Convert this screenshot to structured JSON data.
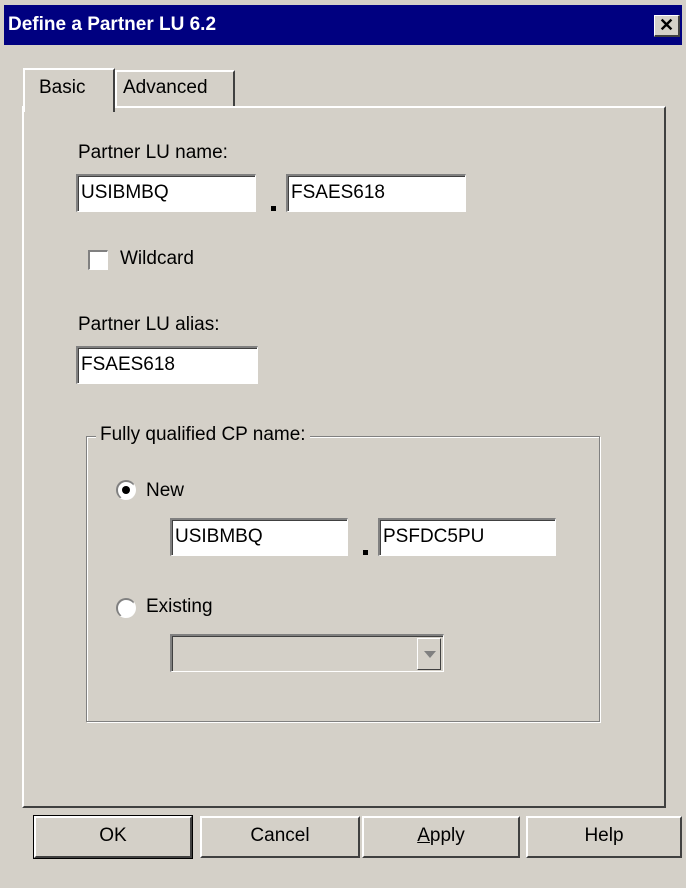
{
  "window": {
    "title": "Define a Partner LU 6.2",
    "close_glyph": "✕"
  },
  "tabs": [
    {
      "label": "Basic",
      "selected": true
    },
    {
      "label": "Advanced",
      "selected": false
    }
  ],
  "partner_lu_name": {
    "label": "Partner LU name:",
    "network": "USIBMBQ",
    "lu": "FSAES618"
  },
  "wildcard": {
    "label": "Wildcard",
    "checked": false
  },
  "partner_lu_alias": {
    "label": "Partner LU alias:",
    "value": "FSAES618"
  },
  "cp_group": {
    "label": "Fully qualified CP name:",
    "new": {
      "label": "New",
      "selected": true,
      "network": "USIBMBQ",
      "cp": "PSFDC5PU"
    },
    "existing": {
      "label": "Existing",
      "selected": false,
      "value": ""
    }
  },
  "buttons": {
    "ok": "OK",
    "cancel": "Cancel",
    "apply_first": "A",
    "apply_rest": "pply",
    "help": "Help"
  }
}
